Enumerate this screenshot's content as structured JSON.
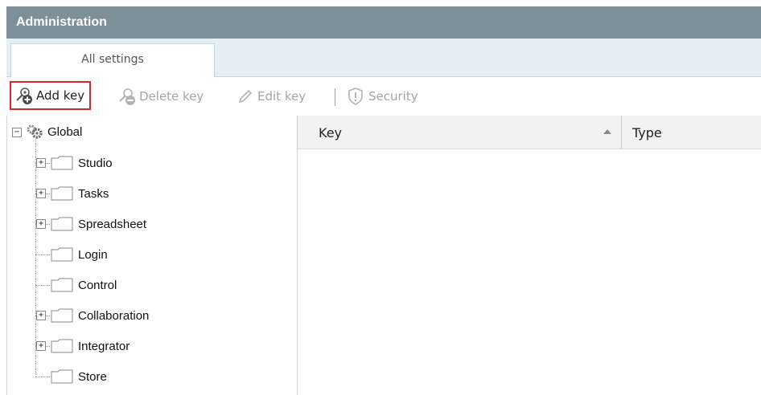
{
  "window": {
    "title": "Administration"
  },
  "tabs": [
    {
      "label": "All settings",
      "active": true
    }
  ],
  "toolbar": {
    "add_key": "Add key",
    "delete_key": "Delete key",
    "edit_key": "Edit key",
    "security": "Security"
  },
  "tree": {
    "root": {
      "label": "Global",
      "icon": "gear-icon",
      "expanded": true
    },
    "children": [
      {
        "label": "Studio",
        "expandable": true
      },
      {
        "label": "Tasks",
        "expandable": true
      },
      {
        "label": "Spreadsheet",
        "expandable": true
      },
      {
        "label": "Login",
        "expandable": false
      },
      {
        "label": "Control",
        "expandable": false
      },
      {
        "label": "Collaboration",
        "expandable": true
      },
      {
        "label": "Integrator",
        "expandable": true
      },
      {
        "label": "Store",
        "expandable": false
      }
    ]
  },
  "grid": {
    "columns": [
      {
        "label": "Key",
        "sort": "ascending"
      },
      {
        "label": "Type"
      }
    ],
    "rows": []
  },
  "colors": {
    "titlebar": "#7d8f98",
    "tabstrip": "#e4eef5",
    "highlight": "#d9262b"
  }
}
